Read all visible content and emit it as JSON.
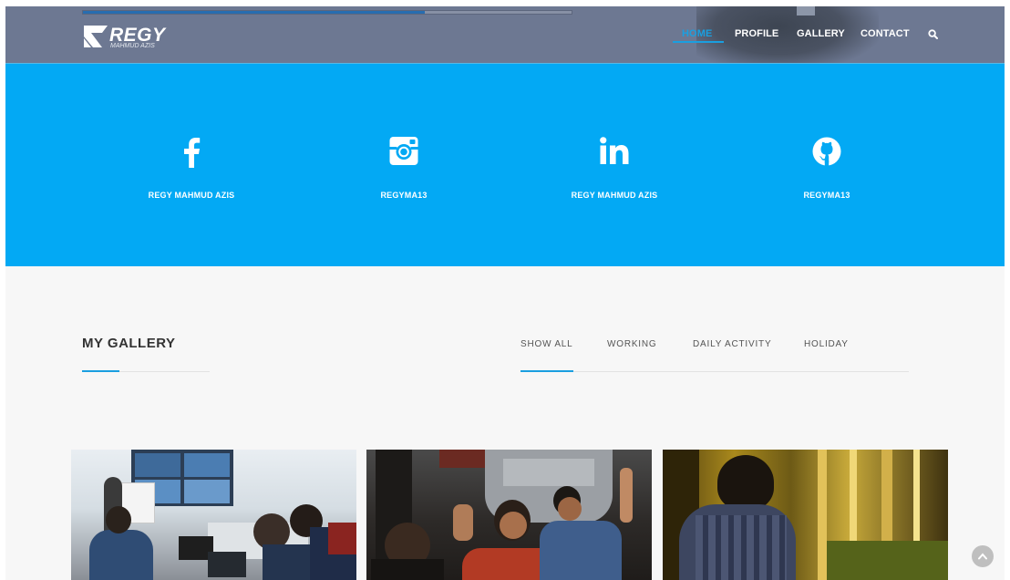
{
  "header": {
    "logo_title": "REGY",
    "logo_subtitle": "MAHMUD AZIS",
    "progress": 0.7
  },
  "nav": {
    "items": [
      {
        "label": "HOME",
        "active": true
      },
      {
        "label": "PROFILE",
        "active": false
      },
      {
        "label": "GALLERY",
        "active": false
      },
      {
        "label": "CONTACT",
        "active": false
      }
    ],
    "search_icon": "search-icon"
  },
  "social": {
    "background": "#03a9f4",
    "items": [
      {
        "icon": "facebook-icon",
        "label": "REGY MAHMUD AZIS"
      },
      {
        "icon": "instagram-icon",
        "label": "REGYMA13"
      },
      {
        "icon": "linkedin-icon",
        "label": "REGY MAHMUD AZIS"
      },
      {
        "icon": "github-icon",
        "label": "REGYMA13"
      }
    ]
  },
  "gallery": {
    "title": "MY GALLERY",
    "filters": [
      {
        "label": "SHOW ALL",
        "active": true
      },
      {
        "label": "WORKING",
        "active": false
      },
      {
        "label": "DAILY ACTIVITY",
        "active": false
      },
      {
        "label": "HOLIDAY",
        "active": false
      }
    ],
    "photos": [
      "meeting-room-photo",
      "night-group-photo",
      "bamboo-garden-photo"
    ]
  },
  "accent_color": "#1a9fe0",
  "scroll_to_top_icon": "chevron-up-icon"
}
